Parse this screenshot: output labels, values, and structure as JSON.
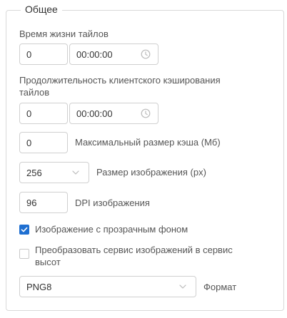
{
  "group": {
    "title": "Общее"
  },
  "tile_lifetime": {
    "label": "Время жизни тайлов",
    "days": "0",
    "time": "00:00:00"
  },
  "client_cache": {
    "label_line1": "Продолжительность клиентского кэширования",
    "label_line2": "тайлов",
    "days": "0",
    "time": "00:00:00"
  },
  "max_cache": {
    "value": "0",
    "label": "Максимальный размер кэша (Мб)"
  },
  "image_size": {
    "value": "256",
    "label": "Размер изображения (px)"
  },
  "image_dpi": {
    "value": "96",
    "label": "DPI изображения"
  },
  "transparent_bg": {
    "checked": true,
    "label": "Изображение с прозрачным фоном"
  },
  "convert_service": {
    "checked": false,
    "label_line1": "Преобразовать сервис изображений в сервис",
    "label_line2": "высот"
  },
  "format": {
    "value": "PNG8",
    "label": "Формат"
  },
  "colors": {
    "accent": "#1f6fd1",
    "border": "#d0d0d0",
    "text": "#333333",
    "muted": "#bbbbbb"
  },
  "icons": {
    "time": "clock-icon",
    "dropdown": "chevron-down-icon",
    "check": "check-icon"
  }
}
